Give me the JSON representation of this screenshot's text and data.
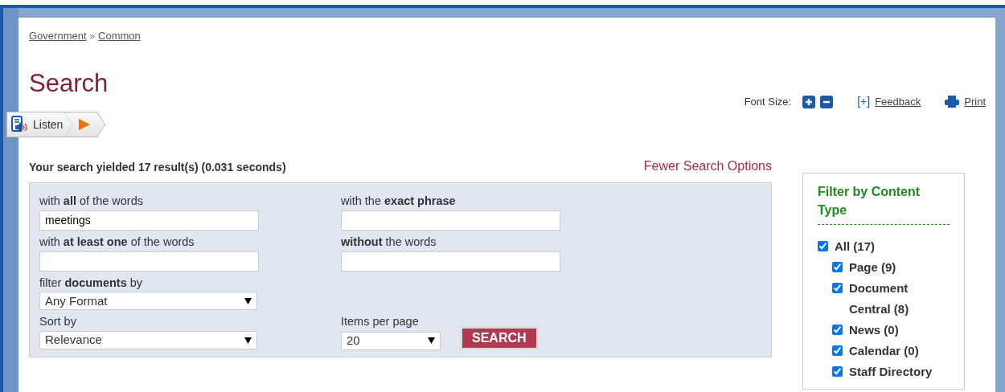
{
  "breadcrumb": [
    {
      "label": "Government"
    },
    {
      "label": "Common"
    }
  ],
  "breadcrumb_separator": "»",
  "title": "Search",
  "tools": {
    "font_size_label": "Font Size:",
    "feedback_prefix": "[+]",
    "feedback": "Feedback",
    "print": "Print"
  },
  "listen": {
    "label": "Listen"
  },
  "results_summary": "Your search yielded 17 result(s) (0.031 seconds)",
  "options_link": "Fewer Search Options",
  "form": {
    "fields": [
      {
        "kind": "text",
        "label": "with **all** of the words",
        "value": "meetings"
      },
      {
        "kind": "text",
        "label": "with the **exact phrase**"
      },
      {
        "kind": "text",
        "label": "with **at least one** of the words"
      },
      {
        "kind": "text",
        "label": "**without** the words"
      },
      {
        "kind": "select",
        "label": "filter **documents** by",
        "value": "Any Format"
      },
      {
        "kind": "empty"
      },
      {
        "kind": "select",
        "label": "Sort by",
        "value": "Relevance"
      },
      {
        "kind": "select-short",
        "label": "Items per page",
        "value": "20"
      }
    ],
    "submit": "SEARCH"
  },
  "filter": {
    "title": "Filter by Content Type",
    "items": [
      {
        "label": "All (17)",
        "checked": true,
        "children": [
          {
            "label": "Page (9)",
            "checked": true
          },
          {
            "label": "Document Central (8)",
            "checked": true
          },
          {
            "label": "News (0)",
            "checked": true
          },
          {
            "label": "Calendar (0)",
            "checked": true
          },
          {
            "label": "Staff Directory",
            "checked": true
          }
        ]
      }
    ]
  }
}
